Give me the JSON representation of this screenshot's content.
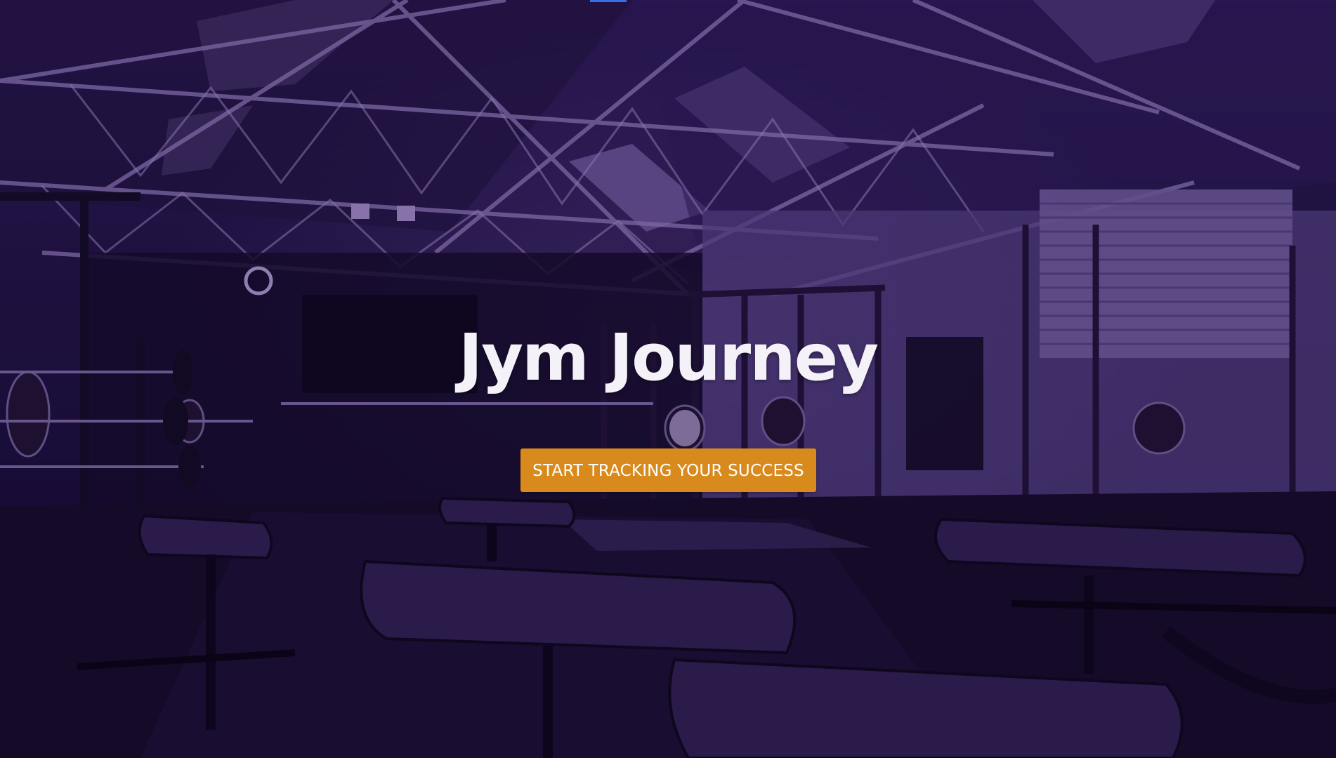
{
  "hero": {
    "title": "Jym Journey",
    "cta_label": "START TRACKING YOUR SUCCESS",
    "background_image": "gym-interior-photo"
  },
  "colors": {
    "overlay_tint": "#3a146e",
    "cta_background": "#d98a1c",
    "title_text": "#f4f2f8",
    "cta_text": "#ffffff",
    "top_strip": "#3a6ee8"
  }
}
